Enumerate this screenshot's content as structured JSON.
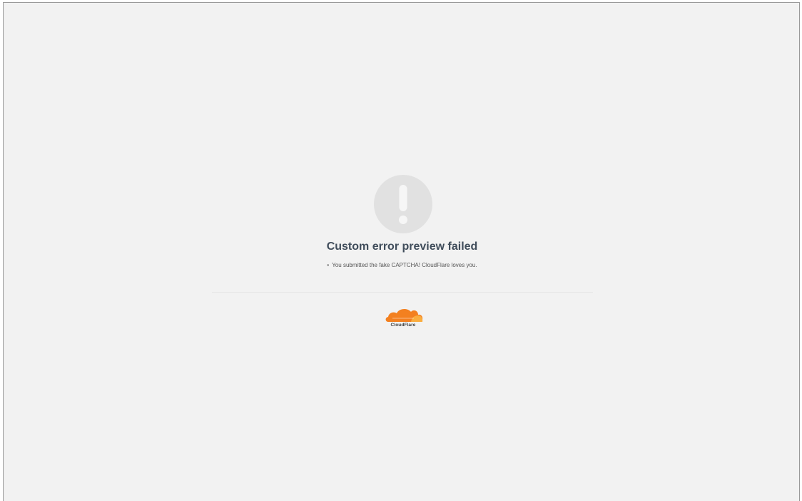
{
  "page": {
    "title": "Custom error preview failed",
    "errors": [
      "You submitted the fake CAPTCHA! CloudFlare loves you."
    ]
  },
  "logo": {
    "text": "CloudFlare",
    "icon": "cloud-icon"
  },
  "alert": {
    "icon": "exclamation-icon"
  },
  "colors": {
    "background": "#f2f2f2",
    "title": "#404d5b",
    "icon_circle": "#e1e1e1",
    "icon_mark": "#f6f6f6",
    "brand_orange": "#f38020",
    "brand_light_orange": "#faad3f"
  }
}
